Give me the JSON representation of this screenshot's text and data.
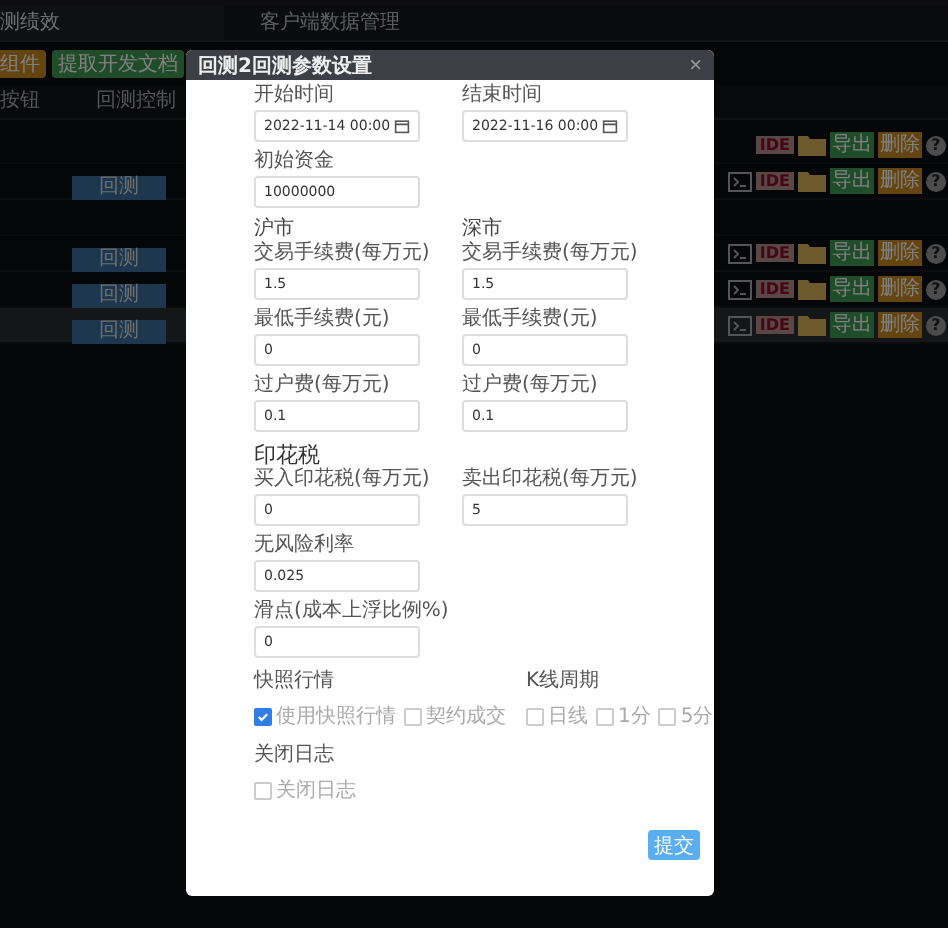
{
  "tabs": [
    {
      "label": "测绩效",
      "selected": true
    },
    {
      "label": "客户端数据管理",
      "selected": false
    }
  ],
  "toolbar": [
    {
      "label": "组件",
      "kind": "warning"
    },
    {
      "label": "提取开发文档",
      "kind": "success"
    }
  ],
  "table": {
    "columns": [
      "按钮",
      "回测控制"
    ],
    "rows": [
      {
        "kind": "tools",
        "selected": false,
        "badge": "IDE",
        "export": "导出",
        "delete": "删除",
        "help": "?"
      },
      {
        "kind": "full",
        "selected": false,
        "button": "回测",
        "badge": "IDE",
        "export": "导出",
        "delete": "删除",
        "help": "?"
      },
      {
        "kind": "empty",
        "selected": false
      },
      {
        "kind": "full",
        "selected": false,
        "button": "回测",
        "badge": "IDE",
        "export": "导出",
        "delete": "删除",
        "help": "?"
      },
      {
        "kind": "full",
        "selected": false,
        "button": "回测",
        "badge": "IDE",
        "export": "导出",
        "delete": "删除",
        "help": "?"
      },
      {
        "kind": "full",
        "selected": true,
        "button": "回测",
        "badge": "IDE",
        "export": "导出",
        "delete": "删除",
        "help": "?"
      }
    ]
  },
  "dialog": {
    "title": "回测2回测参数设置",
    "close": "×",
    "rows": [
      {
        "kind": "fields",
        "fields": [
          {
            "label": "开始时间",
            "value": "2022-11-14 00:00",
            "kind": "date"
          },
          {
            "label": "结束时间",
            "value": "2022-11-16 00:00",
            "kind": "date"
          }
        ]
      },
      {
        "kind": "fields",
        "fields": [
          {
            "label": "初始资金",
            "value": "10000000",
            "kind": "text"
          }
        ]
      },
      {
        "kind": "headings",
        "texts": [
          "沪市",
          "深市"
        ]
      },
      {
        "kind": "fields",
        "fields": [
          {
            "label": "交易手续费(每万元)",
            "value": "1.5",
            "kind": "text"
          },
          {
            "label": "交易手续费(每万元)",
            "value": "1.5",
            "kind": "text"
          }
        ]
      },
      {
        "kind": "fields",
        "fields": [
          {
            "label": "最低手续费(元)",
            "value": "0",
            "kind": "text"
          },
          {
            "label": "最低手续费(元)",
            "value": "0",
            "kind": "text"
          }
        ]
      },
      {
        "kind": "fields",
        "fields": [
          {
            "label": "过户费(每万元)",
            "value": "0.1",
            "kind": "text"
          },
          {
            "label": "过户费(每万元)",
            "value": "0.1",
            "kind": "text"
          }
        ]
      },
      {
        "kind": "section",
        "text": "印花税"
      },
      {
        "kind": "fields",
        "fields": [
          {
            "label": "买入印花税(每万元)",
            "value": "0",
            "kind": "text"
          },
          {
            "label": "卖出印花税(每万元)",
            "value": "5",
            "kind": "text"
          }
        ]
      },
      {
        "kind": "fields",
        "fields": [
          {
            "label": "无风险利率",
            "value": "0.025",
            "kind": "text"
          }
        ]
      },
      {
        "kind": "fields",
        "fields": [
          {
            "label": "滑点(成本上浮比例%)",
            "value": "0",
            "kind": "text"
          }
        ]
      },
      {
        "kind": "options",
        "groups": [
          {
            "label": "快照行情",
            "options": [
              {
                "label": "使用快照行情",
                "checked": true
              },
              {
                "label": "契约成交",
                "checked": false
              }
            ]
          },
          {
            "label": "K线周期",
            "options": [
              {
                "label": "日线",
                "checked": false
              },
              {
                "label": "1分",
                "checked": false
              },
              {
                "label": "5分",
                "checked": false
              }
            ]
          }
        ]
      },
      {
        "kind": "options",
        "groups": [
          {
            "label": "关闭日志",
            "options": [
              {
                "label": "关闭日志",
                "checked": false
              }
            ]
          }
        ]
      }
    ],
    "submit": "提交"
  }
}
